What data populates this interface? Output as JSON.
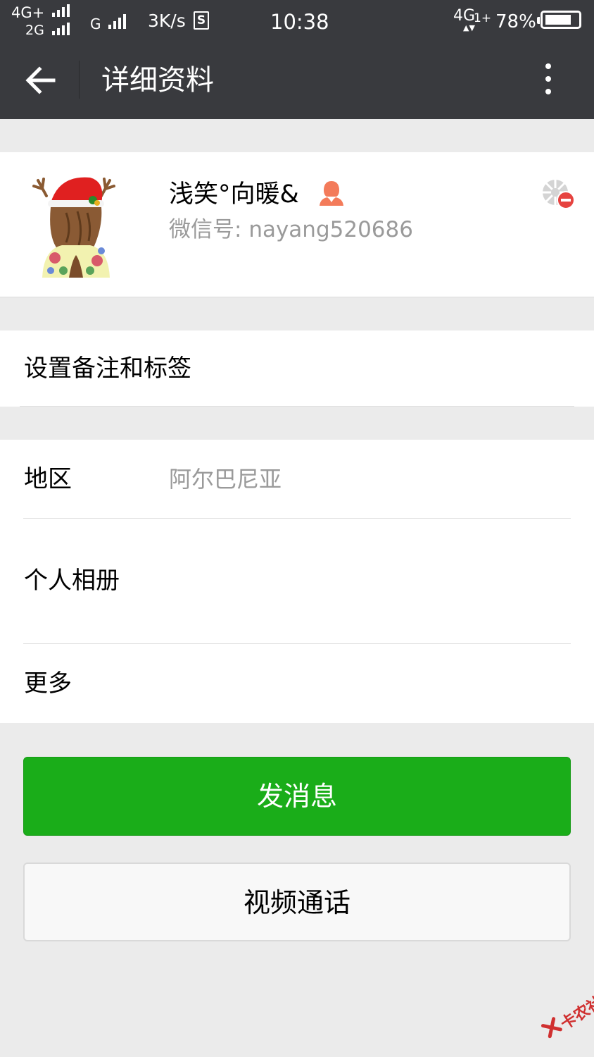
{
  "status_bar": {
    "network1": "4G+",
    "network2": "2G",
    "network3": "G",
    "speed": "3K/s",
    "sim_badge": "S",
    "time": "10:38",
    "network4": "4G",
    "network4_sub": "1+",
    "battery_percent": "78%",
    "battery_level": 0.78
  },
  "toolbar": {
    "title": "详细资料",
    "back_icon": "arrow-left-icon",
    "more_icon": "more-vertical-icon"
  },
  "profile": {
    "nickname": "浅笑°向暖&",
    "gender_icon": "female-person-icon",
    "gender_color": "#f37b5a",
    "wechat_id_label": "微信号: ",
    "wechat_id": "nayang520686",
    "avatar_icon": "avatar-christmas-girl",
    "status_icon": "sns-blocked-icon"
  },
  "remark_cell": {
    "label": "设置备注和标签"
  },
  "info": {
    "region_label": "地区",
    "region_value": "阿尔巴尼亚",
    "album_label": "个人相册",
    "more_label": "更多"
  },
  "actions": {
    "send_message": "发消息",
    "video_call": "视频通话"
  },
  "colors": {
    "header_bg": "#393a3e",
    "primary_green": "#1aad19",
    "page_bg": "#ebebeb"
  },
  "watermark": {
    "text": "卡农社区"
  }
}
